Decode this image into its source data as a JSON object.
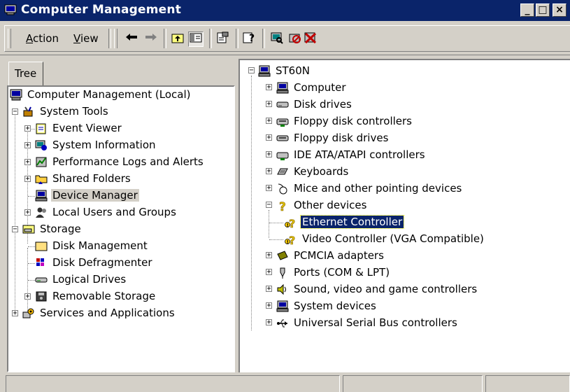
{
  "window": {
    "title": "Computer Management",
    "title_icon": "computer-management-icon",
    "controls": {
      "minimize": "_",
      "maximize": "□",
      "close": "×"
    }
  },
  "menu": {
    "action": {
      "label": "Action",
      "mnemonic": "A",
      "rest": "ction"
    },
    "view": {
      "label": "View",
      "mnemonic": "V",
      "rest": "iew"
    }
  },
  "toolbar": {
    "buttons": [
      {
        "name": "back-icon",
        "glyph": "⇐"
      },
      {
        "name": "forward-icon",
        "glyph": "⇒"
      },
      {
        "name": "up-one-level-icon",
        "glyph": "⤒"
      },
      {
        "name": "show-hide-tree-icon",
        "glyph": "▥"
      },
      {
        "name": "properties-icon",
        "glyph": "🗎"
      },
      {
        "name": "help-icon",
        "glyph": "?"
      },
      {
        "name": "scan-hardware-icon",
        "glyph": "⌕"
      },
      {
        "name": "disable-device-icon",
        "glyph": "⊘"
      },
      {
        "name": "uninstall-device-icon",
        "glyph": "✖"
      }
    ]
  },
  "left_tab": {
    "label": "Tree"
  },
  "left_tree": [
    {
      "label": "Computer Management (Local)",
      "icon": "computer-icon"
    },
    {
      "label": "System Tools",
      "icon": "system-tools-icon"
    },
    {
      "label": "Event Viewer",
      "icon": "event-viewer-icon"
    },
    {
      "label": "System Information",
      "icon": "system-information-icon"
    },
    {
      "label": "Performance Logs and Alerts",
      "icon": "performance-logs-icon"
    },
    {
      "label": "Shared Folders",
      "icon": "shared-folders-icon"
    },
    {
      "label": "Device Manager",
      "icon": "device-manager-icon",
      "selected": true
    },
    {
      "label": "Local Users and Groups",
      "icon": "local-users-icon"
    },
    {
      "label": "Storage",
      "icon": "storage-icon"
    },
    {
      "label": "Disk Management",
      "icon": "disk-management-icon"
    },
    {
      "label": "Disk Defragmenter",
      "icon": "disk-defragmenter-icon"
    },
    {
      "label": "Logical Drives",
      "icon": "logical-drives-icon"
    },
    {
      "label": "Removable Storage",
      "icon": "removable-storage-icon"
    },
    {
      "label": "Services and Applications",
      "icon": "services-applications-icon"
    }
  ],
  "right_tree": [
    {
      "label": "ST60N",
      "icon": "computer-icon"
    },
    {
      "label": "Computer",
      "icon": "computer-icon"
    },
    {
      "label": "Disk drives",
      "icon": "disk-drive-icon"
    },
    {
      "label": "Floppy disk controllers",
      "icon": "floppy-controller-icon"
    },
    {
      "label": "Floppy disk drives",
      "icon": "floppy-drive-icon"
    },
    {
      "label": "IDE ATA/ATAPI controllers",
      "icon": "ide-controller-icon"
    },
    {
      "label": "Keyboards",
      "icon": "keyboard-icon"
    },
    {
      "label": "Mice and other pointing devices",
      "icon": "mouse-icon"
    },
    {
      "label": "Other devices",
      "icon": "unknown-device-icon"
    },
    {
      "label": "Ethernet Controller",
      "icon": "unknown-device-warning-icon",
      "selected": true
    },
    {
      "label": "Video Controller (VGA Compatible)",
      "icon": "unknown-device-warning-icon"
    },
    {
      "label": "PCMCIA adapters",
      "icon": "pcmcia-icon"
    },
    {
      "label": "Ports (COM & LPT)",
      "icon": "port-icon"
    },
    {
      "label": "Sound, video and game controllers",
      "icon": "sound-icon"
    },
    {
      "label": "System devices",
      "icon": "system-devices-icon"
    },
    {
      "label": "Universal Serial Bus controllers",
      "icon": "usb-icon"
    }
  ],
  "colors": {
    "titlebar": "#0a246a",
    "face": "#d4d0c8",
    "selection": "#0a246a",
    "window": "#ffffff"
  }
}
